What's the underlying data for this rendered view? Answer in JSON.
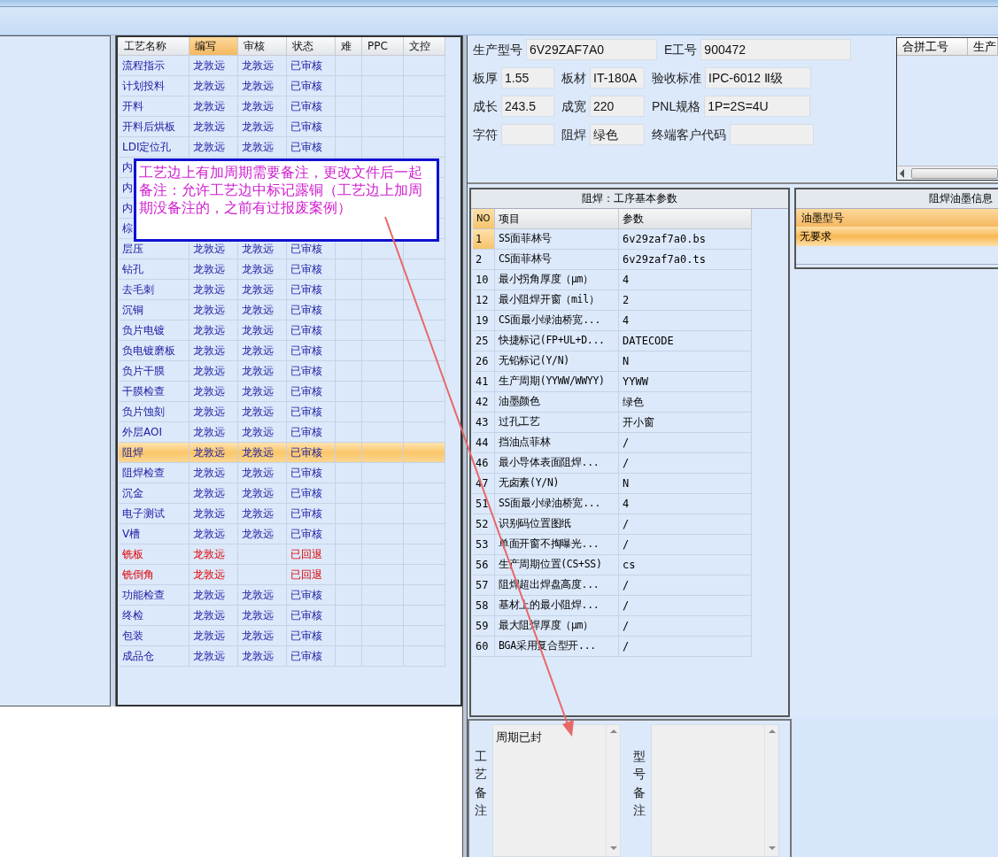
{
  "process_grid": {
    "columns": [
      {
        "label": "工艺名称",
        "selected": false
      },
      {
        "label": "编写",
        "selected": true
      },
      {
        "label": "审核",
        "selected": false
      },
      {
        "label": "状态",
        "selected": false
      },
      {
        "label": "难",
        "selected": false
      },
      {
        "label": "PPC",
        "selected": false
      },
      {
        "label": "文控",
        "selected": false
      }
    ],
    "rows": [
      {
        "cells": [
          "流程指示",
          "龙敦远",
          "龙敦远",
          "已审核"
        ],
        "returned": false,
        "selected": false
      },
      {
        "cells": [
          "计划投料",
          "龙敦远",
          "龙敦远",
          "已审核"
        ],
        "returned": false,
        "selected": false
      },
      {
        "cells": [
          "开料",
          "龙敦远",
          "龙敦远",
          "已审核"
        ],
        "returned": false,
        "selected": false
      },
      {
        "cells": [
          "开料后烘板",
          "龙敦远",
          "龙敦远",
          "已审核"
        ],
        "returned": false,
        "selected": false
      },
      {
        "cells": [
          "LDI定位孔",
          "龙敦远",
          "龙敦远",
          "已审核"
        ],
        "returned": false,
        "selected": false
      },
      {
        "cells": [
          "内"
        ],
        "returned": false,
        "selected": false
      },
      {
        "cells": [
          "内"
        ],
        "returned": false,
        "selected": false
      },
      {
        "cells": [
          "内"
        ],
        "returned": false,
        "selected": false
      },
      {
        "cells": [
          "棕"
        ],
        "returned": false,
        "selected": false
      },
      {
        "cells": [
          "层压",
          "龙敦远",
          "龙敦远",
          "已审核"
        ],
        "returned": false,
        "selected": false
      },
      {
        "cells": [
          "钻孔",
          "龙敦远",
          "龙敦远",
          "已审核"
        ],
        "returned": false,
        "selected": false
      },
      {
        "cells": [
          "去毛刺",
          "龙敦远",
          "龙敦远",
          "已审核"
        ],
        "returned": false,
        "selected": false
      },
      {
        "cells": [
          "沉铜",
          "龙敦远",
          "龙敦远",
          "已审核"
        ],
        "returned": false,
        "selected": false
      },
      {
        "cells": [
          "负片电镀",
          "龙敦远",
          "龙敦远",
          "已审核"
        ],
        "returned": false,
        "selected": false
      },
      {
        "cells": [
          "负电镀磨板",
          "龙敦远",
          "龙敦远",
          "已审核"
        ],
        "returned": false,
        "selected": false
      },
      {
        "cells": [
          "负片干膜",
          "龙敦远",
          "龙敦远",
          "已审核"
        ],
        "returned": false,
        "selected": false
      },
      {
        "cells": [
          "干膜检查",
          "龙敦远",
          "龙敦远",
          "已审核"
        ],
        "returned": false,
        "selected": false
      },
      {
        "cells": [
          "负片蚀刻",
          "龙敦远",
          "龙敦远",
          "已审核"
        ],
        "returned": false,
        "selected": false
      },
      {
        "cells": [
          "外层AOI",
          "龙敦远",
          "龙敦远",
          "已审核"
        ],
        "returned": false,
        "selected": false
      },
      {
        "cells": [
          "阻焊",
          "龙敦远",
          "龙敦远",
          "已审核"
        ],
        "returned": false,
        "selected": true
      },
      {
        "cells": [
          "阻焊检查",
          "龙敦远",
          "龙敦远",
          "已审核"
        ],
        "returned": false,
        "selected": false
      },
      {
        "cells": [
          "沉金",
          "龙敦远",
          "龙敦远",
          "已审核"
        ],
        "returned": false,
        "selected": false
      },
      {
        "cells": [
          "电子测试",
          "龙敦远",
          "龙敦远",
          "已审核"
        ],
        "returned": false,
        "selected": false
      },
      {
        "cells": [
          "V槽",
          "龙敦远",
          "龙敦远",
          "已审核"
        ],
        "returned": false,
        "selected": false
      },
      {
        "cells": [
          "铣板",
          "龙敦远",
          "",
          "已回退"
        ],
        "returned": true,
        "selected": false
      },
      {
        "cells": [
          "铣倒角",
          "龙敦远",
          "",
          "已回退"
        ],
        "returned": true,
        "selected": false
      },
      {
        "cells": [
          "功能检查",
          "龙敦远",
          "龙敦远",
          "已审核"
        ],
        "returned": false,
        "selected": false
      },
      {
        "cells": [
          "终检",
          "龙敦远",
          "龙敦远",
          "已审核"
        ],
        "returned": false,
        "selected": false
      },
      {
        "cells": [
          "包装",
          "龙敦远",
          "龙敦远",
          "已审核"
        ],
        "returned": false,
        "selected": false
      },
      {
        "cells": [
          "成品仓",
          "龙敦远",
          "龙敦远",
          "已审核"
        ],
        "returned": false,
        "selected": false
      }
    ]
  },
  "annotation": {
    "text": "工艺边上有加周期需要备注，更改文件后一起备注：允许工艺边中标记露铜（工艺边上加周期没备注的，之前有过报废案例）"
  },
  "info": {
    "fields": [
      {
        "label": "生产型号",
        "value": "6V29ZAF7A0"
      },
      {
        "label": "E工号",
        "value": "900472"
      },
      {
        "label": "板厚",
        "value": "1.55"
      },
      {
        "label": "板材",
        "value": "IT-180A"
      },
      {
        "label": "验收标准",
        "value": "IPC-6012 Ⅱ级"
      },
      {
        "label": "成长",
        "value": "243.5"
      },
      {
        "label": "成宽",
        "value": "220"
      },
      {
        "label": "PNL规格",
        "value": "1P=2S=4U"
      },
      {
        "label": "字符"
      },
      {
        "label": "阻焊",
        "value": "绿色"
      },
      {
        "label": "终端客户代码"
      }
    ]
  },
  "merge_list": {
    "columns": [
      "合拼工号",
      "生产"
    ]
  },
  "params": {
    "title": "阻焊：工序基本参数",
    "columns": [
      "NO",
      "项目",
      "参数"
    ],
    "rows": [
      {
        "no": "1",
        "item": "SS面菲林号",
        "value": "6v29zaf7a0.bs",
        "selected": true
      },
      {
        "no": "2",
        "item": "CS面菲林号",
        "value": "6v29zaf7a0.ts",
        "selected": false
      },
      {
        "no": "10",
        "item": "最小拐角厚度（μm）",
        "value": "4",
        "selected": false
      },
      {
        "no": "12",
        "item": "最小阻焊开窗（mil）",
        "value": "2",
        "selected": false
      },
      {
        "no": "19",
        "item": "CS面最小绿油桥宽...",
        "value": "4",
        "selected": false
      },
      {
        "no": "25",
        "item": "快捷标记(FP+UL+D...",
        "value": "DATECODE",
        "selected": false
      },
      {
        "no": "26",
        "item": "无铅标记(Y/N)",
        "value": "N",
        "selected": false
      },
      {
        "no": "41",
        "item": "生产周期(YYWW/WWYY)",
        "value": "YYWW",
        "selected": false
      },
      {
        "no": "42",
        "item": "油墨颜色",
        "value": "绿色",
        "selected": false
      },
      {
        "no": "43",
        "item": "过孔工艺",
        "value": "开小窗",
        "selected": false
      },
      {
        "no": "44",
        "item": "挡油点菲林",
        "value": "/",
        "selected": false
      },
      {
        "no": "46",
        "item": "最小导体表面阻焊...",
        "value": "/",
        "selected": false
      },
      {
        "no": "47",
        "item": "无卤素(Y/N)",
        "value": "N",
        "selected": false
      },
      {
        "no": "51",
        "item": "SS面最小绿油桥宽...",
        "value": "4",
        "selected": false
      },
      {
        "no": "52",
        "item": "识别码位置图纸",
        "value": "/",
        "selected": false
      },
      {
        "no": "53",
        "item": "单面开窗不掏曝光...",
        "value": "/",
        "selected": false
      },
      {
        "no": "56",
        "item": "生产周期位置(CS+SS)",
        "value": "cs",
        "selected": false
      },
      {
        "no": "57",
        "item": "阻焊超出焊盘高度...",
        "value": "/",
        "selected": false
      },
      {
        "no": "58",
        "item": "基材上的最小阻焊...",
        "value": "/",
        "selected": false
      },
      {
        "no": "59",
        "item": "最大阻焊厚度（μm）",
        "value": "/",
        "selected": false
      },
      {
        "no": "60",
        "item": "BGA采用复合型开...",
        "value": "/",
        "selected": false
      }
    ]
  },
  "ink": {
    "title": "阻焊油墨信息",
    "column": "油墨型号",
    "rows": [
      {
        "label": "无要求",
        "selected": true
      }
    ]
  },
  "remarks": [
    {
      "label": "工艺备注",
      "value": "周期已封"
    },
    {
      "label": "型号备注"
    }
  ]
}
